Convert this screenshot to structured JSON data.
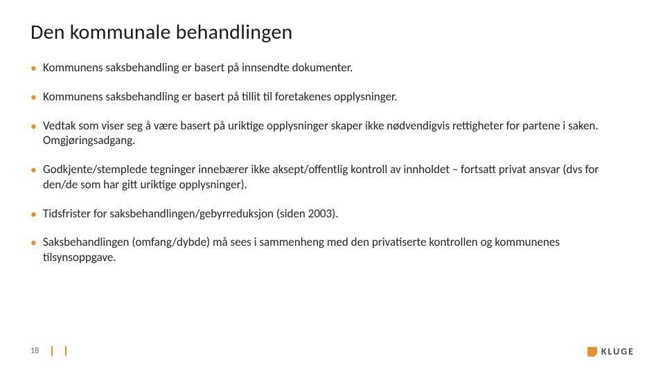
{
  "slide": {
    "title": "Den kommunale behandlingen",
    "bullets": [
      "Kommunens saksbehandling er basert på innsendte dokumenter.",
      "Kommunens saksbehandling er basert på tillit til foretakenes opplysninger.",
      "Vedtak som viser seg å være basert på uriktige opplysninger skaper ikke nødvendigvis rettigheter for partene i saken. Omgjøringsadgang.",
      "Godkjente/stemplede tegninger innebærer ikke aksept/offentlig kontroll av innholdet – fortsatt privat ansvar (dvs for den/de som har gitt uriktige opplysninger).",
      "Tidsfrister for saksbehandlingen/gebyrreduksjon (siden 2003).",
      "Saksbehandlingen (omfang/dybde) må sees i sammenheng med den privatiserte kontrollen og kommunenes tilsynsoppgave."
    ],
    "page_number": "18",
    "logo_text": "KLUGE"
  },
  "colors": {
    "accent": "#e0932e"
  }
}
